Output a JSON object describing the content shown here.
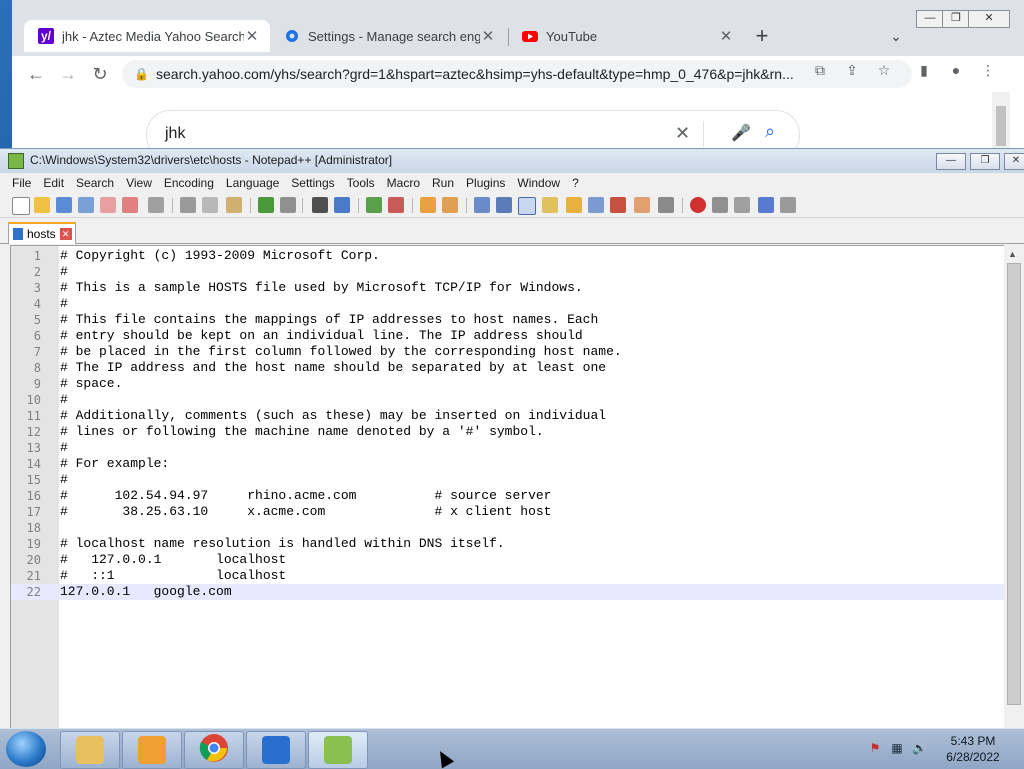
{
  "browser": {
    "tabs": [
      {
        "title": "jhk - Aztec Media Yahoo Search I",
        "icon": "yahoo-icon"
      },
      {
        "title": "Settings - Manage search engine",
        "icon": "gear-icon"
      },
      {
        "title": "YouTube",
        "icon": "youtube-icon"
      }
    ],
    "url": "search.yahoo.com/yhs/search?grd=1&hspart=aztec&hsimp=yhs-default&type=hmp_0_476&p=jhk&rn...",
    "search_query": "jhk"
  },
  "notepad": {
    "window_title": "C:\\Windows\\System32\\drivers\\etc\\hosts - Notepad++ [Administrator]",
    "menu": [
      "File",
      "Edit",
      "Search",
      "View",
      "Encoding",
      "Language",
      "Settings",
      "Tools",
      "Macro",
      "Run",
      "Plugins",
      "Window",
      "?"
    ],
    "doc_tab": "hosts",
    "lines": [
      "# Copyright (c) 1993-2009 Microsoft Corp.",
      "#",
      "# This is a sample HOSTS file used by Microsoft TCP/IP for Windows.",
      "#",
      "# This file contains the mappings of IP addresses to host names. Each",
      "# entry should be kept on an individual line. The IP address should",
      "# be placed in the first column followed by the corresponding host name.",
      "# The IP address and the host name should be separated by at least one",
      "# space.",
      "#",
      "# Additionally, comments (such as these) may be inserted on individual",
      "# lines or following the machine name denoted by a '#' symbol.",
      "#",
      "# For example:",
      "#",
      "#      102.54.94.97     rhino.acme.com          # source server",
      "#       38.25.63.10     x.acme.com              # x client host",
      "",
      "# localhost name resolution is handled within DNS itself.",
      "#   127.0.0.1       localhost",
      "#   ::1             localhost",
      "127.0.0.1   google.com"
    ]
  },
  "taskbar": {
    "time": "5:43 PM",
    "date": "6/28/2022"
  }
}
